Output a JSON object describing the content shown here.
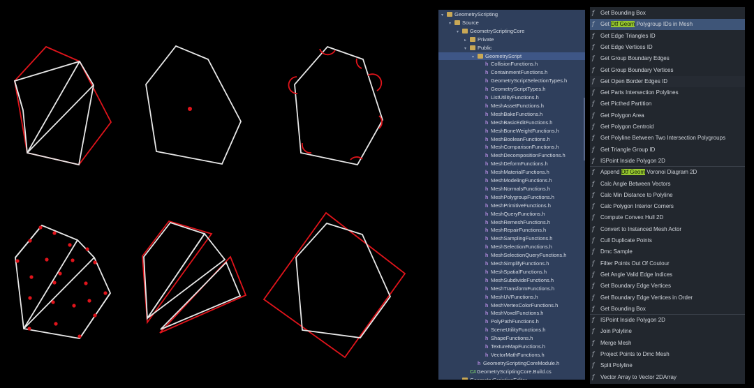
{
  "tree": {
    "items": [
      {
        "label": "GeometryScripting",
        "icon": "folder",
        "indent": 0,
        "arrow": "▾"
      },
      {
        "label": "Source",
        "icon": "folder",
        "indent": 1,
        "arrow": "▾"
      },
      {
        "label": "GeometryScriptingCore",
        "icon": "folder",
        "indent": 2,
        "arrow": "▾"
      },
      {
        "label": "Private",
        "icon": "folder",
        "indent": 3,
        "arrow": "▸"
      },
      {
        "label": "Public",
        "icon": "folder",
        "indent": 3,
        "arrow": "▾"
      },
      {
        "label": "GeometryScript",
        "icon": "folder",
        "indent": 4,
        "arrow": "▾",
        "selected": true
      },
      {
        "label": "CollisionFunctions.h",
        "icon": "h",
        "indent": 5
      },
      {
        "label": "ContainmentFunctions.h",
        "icon": "h",
        "indent": 5
      },
      {
        "label": "GeometryScriptSelectionTypes.h",
        "icon": "h",
        "indent": 5
      },
      {
        "label": "GeometryScriptTypes.h",
        "icon": "h",
        "indent": 5
      },
      {
        "label": "ListUtilityFunctions.h",
        "icon": "h",
        "indent": 5
      },
      {
        "label": "MeshAssetFunctions.h",
        "icon": "h",
        "indent": 5
      },
      {
        "label": "MeshBakeFunctions.h",
        "icon": "h",
        "indent": 5
      },
      {
        "label": "MeshBasicEditFunctions.h",
        "icon": "h",
        "indent": 5
      },
      {
        "label": "MeshBoneWeightFunctions.h",
        "icon": "h",
        "indent": 5
      },
      {
        "label": "MeshBooleanFunctions.h",
        "icon": "h",
        "indent": 5
      },
      {
        "label": "MeshComparisonFunctions.h",
        "icon": "h",
        "indent": 5
      },
      {
        "label": "MeshDecompositionFunctions.h",
        "icon": "h",
        "indent": 5
      },
      {
        "label": "MeshDeformFunctions.h",
        "icon": "h",
        "indent": 5
      },
      {
        "label": "MeshMaterialFunctions.h",
        "icon": "h",
        "indent": 5
      },
      {
        "label": "MeshModelingFunctions.h",
        "icon": "h",
        "indent": 5
      },
      {
        "label": "MeshNormalsFunctions.h",
        "icon": "h",
        "indent": 5
      },
      {
        "label": "MeshPolygroupFunctions.h",
        "icon": "h",
        "indent": 5
      },
      {
        "label": "MeshPrimitiveFunctions.h",
        "icon": "h",
        "indent": 5
      },
      {
        "label": "MeshQueryFunctions.h",
        "icon": "h",
        "indent": 5
      },
      {
        "label": "MeshRemeshFunctions.h",
        "icon": "h",
        "indent": 5
      },
      {
        "label": "MeshRepairFunctions.h",
        "icon": "h",
        "indent": 5
      },
      {
        "label": "MeshSamplingFunctions.h",
        "icon": "h",
        "indent": 5
      },
      {
        "label": "MeshSelectionFunctions.h",
        "icon": "h",
        "indent": 5
      },
      {
        "label": "MeshSelectionQueryFunctions.h",
        "icon": "h",
        "indent": 5
      },
      {
        "label": "MeshSimplifyFunctions.h",
        "icon": "h",
        "indent": 5
      },
      {
        "label": "MeshSpatialFunctions.h",
        "icon": "h",
        "indent": 5
      },
      {
        "label": "MeshSubdivideFunctions.h",
        "icon": "h",
        "indent": 5
      },
      {
        "label": "MeshTransformFunctions.h",
        "icon": "h",
        "indent": 5
      },
      {
        "label": "MeshUVFunctions.h",
        "icon": "h",
        "indent": 5
      },
      {
        "label": "MeshVertexColorFunctions.h",
        "icon": "h",
        "indent": 5
      },
      {
        "label": "MeshVoxelFunctions.h",
        "icon": "h",
        "indent": 5
      },
      {
        "label": "PolyPathFunctions.h",
        "icon": "h",
        "indent": 5
      },
      {
        "label": "SceneUtilityFunctions.h",
        "icon": "h",
        "indent": 5
      },
      {
        "label": "ShapeFunctions.h",
        "icon": "h",
        "indent": 5
      },
      {
        "label": "TextureMapFunctions.h",
        "icon": "h",
        "indent": 5
      },
      {
        "label": "VectorMathFunctions.h",
        "icon": "h",
        "indent": 5
      },
      {
        "label": "GeometryScriptingCoreModule.h",
        "icon": "h",
        "indent": 4
      },
      {
        "label": "GeometryScriptingCore.Build.cs",
        "icon": "cs",
        "indent": 3
      },
      {
        "label": "GeometryScriptingEditor",
        "icon": "folder",
        "indent": 2,
        "arrow": "▸"
      }
    ]
  },
  "nodes": {
    "items": [
      {
        "pre": "Get Bounding Box"
      },
      {
        "pre": "Get ",
        "mark": "Dtf Geom",
        "post": " Polygroup IDs in Mesh",
        "highlight": true
      },
      {
        "pre": "Get Edge Triangles ID"
      },
      {
        "pre": "Get Edge Vertices ID"
      },
      {
        "pre": "Get Group Boundary Edges"
      },
      {
        "pre": "Get Group Boundary Vertices"
      },
      {
        "pre": "Get Open Border Edges ID",
        "alt": true
      },
      {
        "pre": "Get Parts Intersection Polylines"
      },
      {
        "pre": "Get Picthed Partition"
      },
      {
        "pre": "Get Polygon Area"
      },
      {
        "pre": "Get Polygon Centroid"
      },
      {
        "pre": "Get Polyline Between Two Intersection Polygroups"
      },
      {
        "pre": "Get Triangle Group ID"
      },
      {
        "pre": "ISPoint Inside Polygon 2D"
      },
      {
        "pre": "Append ",
        "mark": "Dtf Geom",
        "post": " Voronoi Diagram 2D",
        "sep": true
      },
      {
        "pre": "Calc Angle Between Vectors"
      },
      {
        "pre": "Calc Min Distance to Polyline"
      },
      {
        "pre": "Calc Polygon Interior Corners"
      },
      {
        "pre": "Compute Convex Hull 2D"
      },
      {
        "pre": "Convert to Instanced Mesh Actor"
      },
      {
        "pre": "Cull Duplicate Points"
      },
      {
        "pre": "Dmc Sample"
      },
      {
        "pre": "Filter Points Out Of Coutour"
      },
      {
        "pre": "Get Angle Valid Edge Indices"
      },
      {
        "pre": "Get Boundary Edge Vertices"
      },
      {
        "pre": "Get Boundary Edge Vertices in Order"
      },
      {
        "pre": "Get Bounding Box"
      },
      {
        "pre": "ISPoint Inside Polygon 2D",
        "sep": true
      },
      {
        "pre": "Join Polyline"
      },
      {
        "pre": "Merge Mesh"
      },
      {
        "pre": "Project Points to Dmc Mesh"
      },
      {
        "pre": "Split Polyline"
      },
      {
        "pre": "Vector Array to Vector 2DArray"
      }
    ],
    "function_icon": "function-icon"
  },
  "colors": {
    "white": "#e8e8e8",
    "red": "#e0141b",
    "highlight_mark": "#97c72f"
  }
}
